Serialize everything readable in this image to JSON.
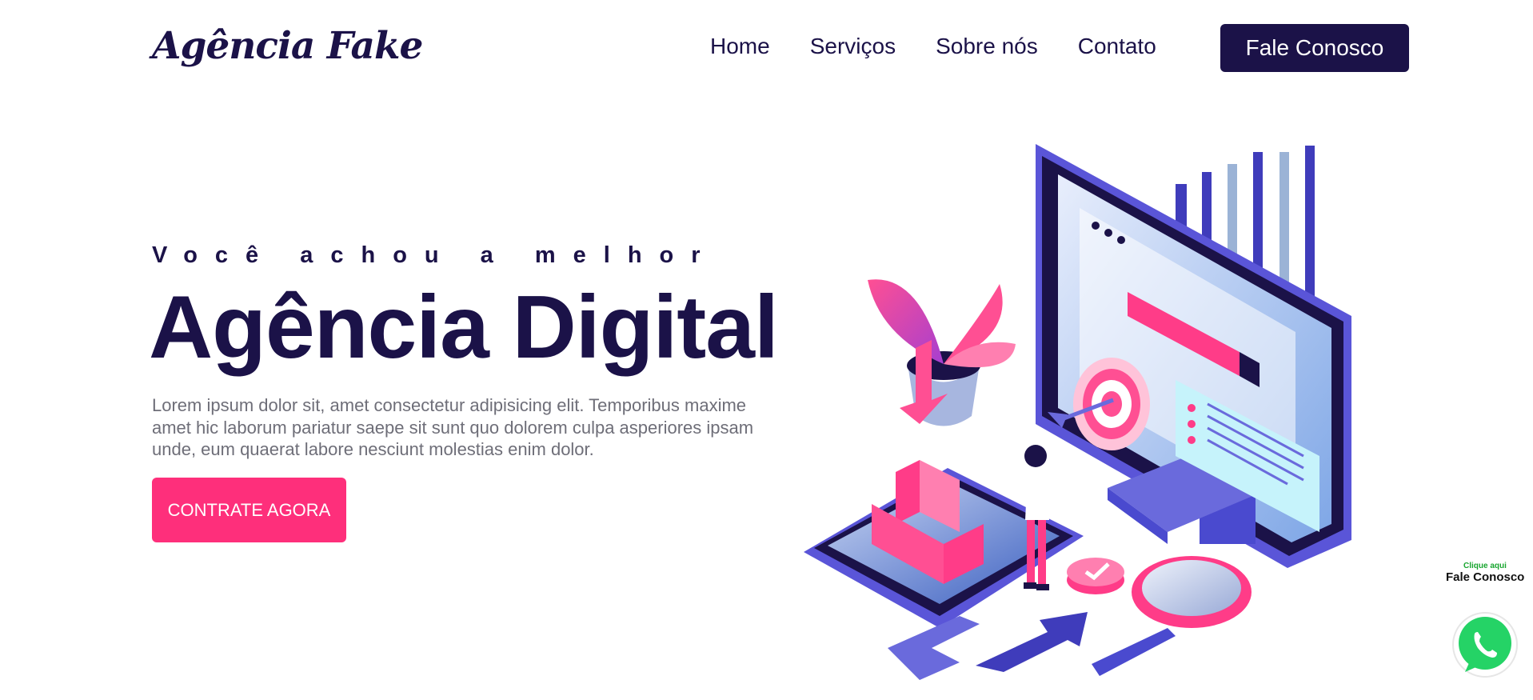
{
  "header": {
    "logo": "Agência Fake",
    "nav": [
      "Home",
      "Serviços",
      "Sobre nós",
      "Contato"
    ],
    "cta_label": "Fale Conosco"
  },
  "hero": {
    "eyebrow": "Você achou a melhor",
    "title": "Agência Digital",
    "description": "Lorem ipsum dolor sit, amet consectetur adipisicing elit. Temporibus maxime amet hic laborum pariatur saepe sit sunt quo dolorem culpa asperiores ipsam unde, eum quaerat labore nesciunt molestias enim dolor.",
    "cta_label": "CONTRATE AGORA"
  },
  "whatsapp": {
    "small_label": "Clique aqui",
    "big_label": "Fale Conosco",
    "icon": "whatsapp-icon"
  },
  "colors": {
    "primary": "#1b1248",
    "accent": "#fe2f7b",
    "purple": "#6a5fdc",
    "whatsapp": "#25d366"
  }
}
